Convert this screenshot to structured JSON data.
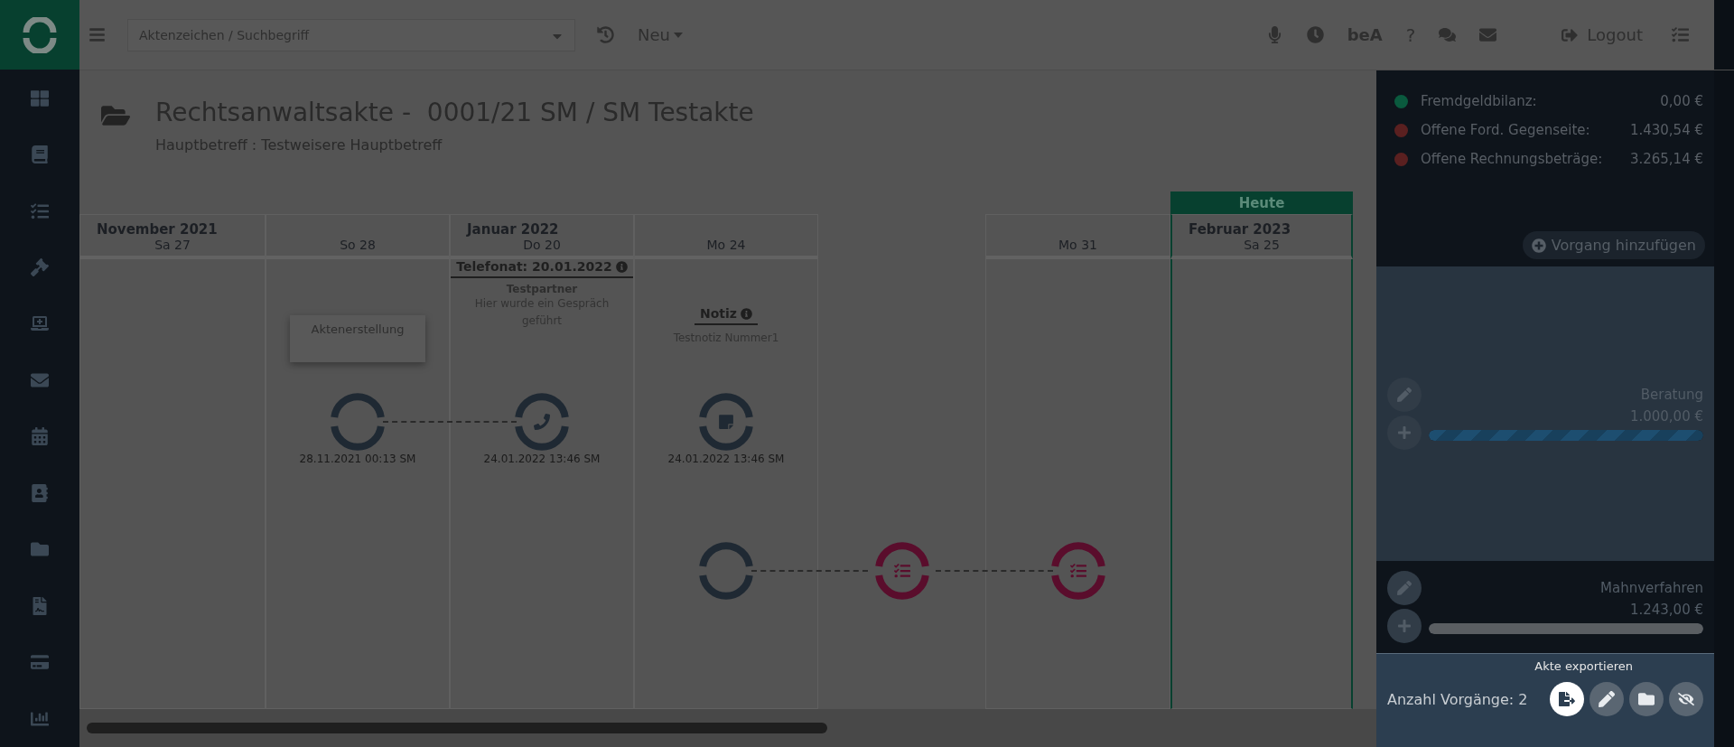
{
  "topbar": {
    "search": {
      "placeholder": "Aktenzeichen / Suchbegriff"
    },
    "new_menu": "Neu",
    "bea": "beA",
    "help": "?",
    "logout": "Logout"
  },
  "header": {
    "title": "Rechtsanwaltsakte -  0001/21 SM / SM Testakte",
    "subtitle": "Hauptbetreff : Testweisere Hauptbetreff"
  },
  "timeline": {
    "today_label": "Heute",
    "columns": [
      {
        "kind": "day",
        "month": "November 2021",
        "day": "Sa 27"
      },
      {
        "kind": "day",
        "day": "So 28",
        "upper": {
          "kind": "creation",
          "card": "Aktenerstellung",
          "date": "28.11.2021 00:13 SM"
        }
      },
      {
        "kind": "day",
        "month": "Januar 2022",
        "day": "Do 20",
        "upper": {
          "kind": "call",
          "title": "Telefonat: 20.01.2022",
          "partner": "Testpartner",
          "text": "Hier wurde ein Gespräch geführt",
          "date": "24.01.2022 13:46 SM",
          "linked": true
        }
      },
      {
        "kind": "day",
        "day": "Mo 24",
        "upper": {
          "kind": "note",
          "title": "Notiz",
          "text": "Testnotiz Nummer1",
          "date": "24.01.2022 13:46 SM"
        },
        "lower": {
          "kind": "plain"
        }
      },
      {
        "kind": "gap",
        "lower": {
          "kind": "task",
          "linked": true
        }
      },
      {
        "kind": "day",
        "day": "Mo 31",
        "lower": {
          "kind": "task",
          "linked": true
        }
      },
      {
        "kind": "day",
        "month": "Februar 2023",
        "day": "Sa 25",
        "today": true
      }
    ]
  },
  "panel": {
    "balances": [
      {
        "label": "Fremdgeldbilanz:",
        "value": "0,00 €",
        "color": "#0a5a3e"
      },
      {
        "label": "Offene Ford. Gegenseite:",
        "value": "1.430,54 €",
        "color": "#5a2020"
      },
      {
        "label": "Offene Rechnungsbeträge:",
        "value": "3.265,14 €",
        "color": "#5a2020"
      }
    ],
    "add_button": "Vorgang hinzufügen",
    "procedures": [
      {
        "name": "Beratung",
        "amount": "1.000,00 €",
        "level": 1,
        "selected": true
      },
      {
        "name": "Mahnverfahren",
        "amount": "1.243,00 €",
        "level": 1,
        "selected": false
      }
    ],
    "footer": {
      "count": "Anzahl Vorgänge: 2",
      "tooltip": "Akte exportieren",
      "actions": [
        {
          "kind": "export",
          "active": true
        },
        {
          "kind": "edit",
          "active": false
        },
        {
          "kind": "folder",
          "active": false
        },
        {
          "kind": "hide",
          "active": false
        }
      ]
    }
  }
}
